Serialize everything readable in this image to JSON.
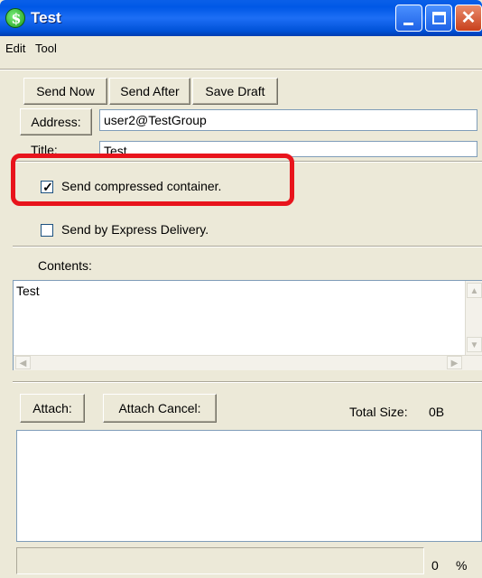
{
  "window": {
    "title": "Test"
  },
  "menu": {
    "edit": "Edit",
    "tool": "Tool"
  },
  "toolbar": {
    "send_now": "Send Now",
    "send_after": "Send After",
    "save_draft": "Save Draft"
  },
  "address": {
    "button_label": "Address:",
    "value": "user2@TestGroup"
  },
  "title_field": {
    "label": "Title:",
    "value": "Test"
  },
  "options": {
    "compressed": {
      "label": "Send compressed container.",
      "checked": true
    },
    "express": {
      "label": "Send by Express Delivery.",
      "checked": false
    }
  },
  "contents": {
    "label": "Contents:",
    "text": "Test"
  },
  "attachments": {
    "attach_label": "Attach:",
    "attach_cancel_label": "Attach Cancel:",
    "total_size_label": "Total Size:",
    "total_size_value": "0B"
  },
  "status": {
    "progress_value": "0",
    "progress_unit": "%"
  },
  "colors": {
    "highlight": "#e8141c",
    "titlebar": "#0058e6"
  }
}
